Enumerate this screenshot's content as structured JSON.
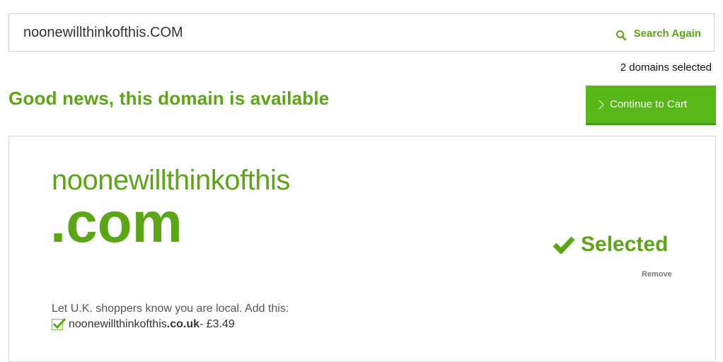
{
  "search": {
    "value": "noonewillthinkofthis.COM",
    "button_label": "Search Again"
  },
  "cart": {
    "selected_count_text": "2 domains selected",
    "continue_label": "Continue to Cart"
  },
  "result": {
    "headline": "Good news, this domain is available",
    "domain_name": "noonewillthinkofthis",
    "tld": ".com",
    "status": "Selected",
    "remove_label": "Remove"
  },
  "upsell": {
    "text": "Let U.K. shoppers know you are local. Add this:",
    "domain_name": "noonewillthinkofthis",
    "tld": ".co.uk",
    "price": " - £3.49",
    "checked": true
  },
  "colors": {
    "accent": "#5ba614",
    "button": "#5ab719"
  },
  "icons": [
    "search-icon",
    "chevron-right-icon",
    "checkmark-icon",
    "checkbox-checked-icon"
  ]
}
